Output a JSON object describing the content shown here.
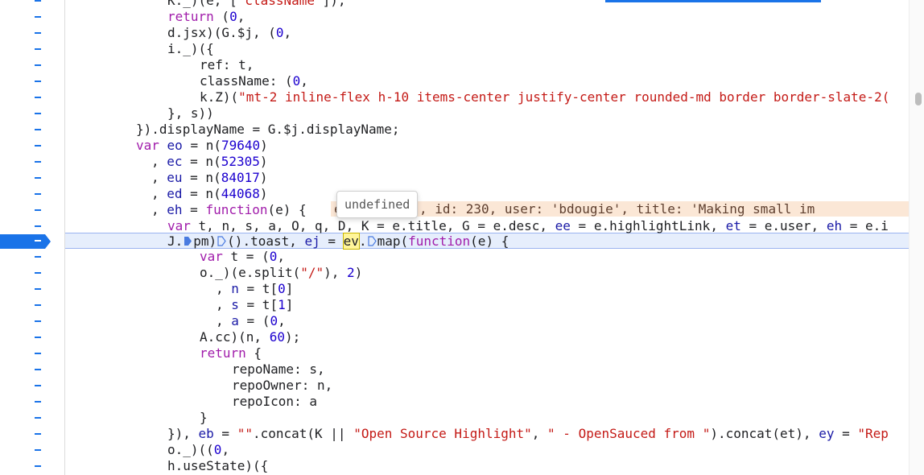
{
  "tooltip": {
    "text": "undefined"
  },
  "inline_values": "e  Array(5), id: 230, user: 'bdougie', title: 'Making small im",
  "colors": {
    "breakpoint": "#1a73e8",
    "exec_line_bg": "#e6eefc",
    "keyword": "#a11dab",
    "number": "#1c00cf",
    "string": "#c41a16"
  },
  "lines": {
    "l0": {
      "a": "K._)(e, [",
      "s": "\"className\"",
      "b": "]);"
    },
    "l1": {
      "kw": "return",
      "a": " (",
      "n": "0",
      "b": ","
    },
    "l2": {
      "a": "d.jsx)(G.$j, (",
      "n": "0",
      "b": ","
    },
    "l3": {
      "a": "i._)({"
    },
    "l4": {
      "a": "ref: t,"
    },
    "l5": {
      "a": "className: (",
      "n": "0",
      "b": ","
    },
    "l6": {
      "a": "k.Z)(",
      "s": "\"mt-2 inline-flex h-10 items-center justify-center rounded-md border border-slate-2("
    },
    "l7": {
      "a": "}, s))"
    },
    "l8": {
      "a": "}).displayName = G.$j.displayName;"
    },
    "l9": {
      "kw": "var",
      "v": "eo",
      "a": " = n(",
      "n": "79640",
      "b": ")"
    },
    "l10": {
      "a": ", ",
      "v": "ec",
      "b": " = n(",
      "n": "52305",
      "c": ")"
    },
    "l11": {
      "a": ", ",
      "v": "eu",
      "b": " = n(",
      "n": "84017",
      "c": ")"
    },
    "l12": {
      "a": ", ",
      "v": "ed",
      "b": " = n(",
      "n": "44068",
      "c": ")"
    },
    "l13": {
      "a": ", ",
      "v": "eh",
      "b": " = ",
      "kw": "function",
      "c": "(e) {"
    },
    "l14": {
      "kw": "var",
      "a": " t, n, s, a, O, q, D, K = e.title, G = e.desc, ",
      "v1": "ee",
      "b": " = e.highlightLink, ",
      "v2": "et",
      "c": " = e.user, ",
      "v3": "eh",
      "d": " = e.i"
    },
    "l15": {
      "a": "J.",
      "b": "pm)",
      "c": "().toast, ",
      "v": "ej",
      "d": " = ",
      "hw": "ev",
      "e": ".",
      "f": "map(",
      "kw": "function",
      "g": "(e) {"
    },
    "l16": {
      "kw": "var",
      "a": " t = (",
      "n": "0",
      "b": ","
    },
    "l17": {
      "a": "o._)(e.split(",
      "s": "\"/\"",
      "b": "), ",
      "n": "2",
      "c": ")"
    },
    "l18": {
      "a": ", ",
      "v": "n",
      "b": " = t[",
      "n": "0",
      "c": "]"
    },
    "l19": {
      "a": ", ",
      "v": "s",
      "b": " = t[",
      "n": "1",
      "c": "]"
    },
    "l20": {
      "a": ", ",
      "v": "a",
      "b": " = (",
      "n": "0",
      "c": ","
    },
    "l21": {
      "a": "A.cc)(n, ",
      "n": "60",
      "b": ");"
    },
    "l22": {
      "kw": "return",
      "a": " {"
    },
    "l23": {
      "a": "repoName: s,"
    },
    "l24": {
      "a": "repoOwner: n,"
    },
    "l25": {
      "a": "repoIcon: a"
    },
    "l26": {
      "a": "}"
    },
    "l27": {
      "a": "}), ",
      "v": "eb",
      "b": " = ",
      "s1": "\"\"",
      "c": ".concat(K || ",
      "s2": "\"Open Source Highlight\"",
      "d": ", ",
      "s3": "\" - OpenSauced from \"",
      "e": ").concat(et), ",
      "v2": "ey",
      "f": " = ",
      "s4": "\"Rep"
    },
    "l28": {
      "a": "o._)((",
      "n": "0",
      "b": ","
    },
    "l29": {
      "a": "h.useState)({"
    }
  }
}
